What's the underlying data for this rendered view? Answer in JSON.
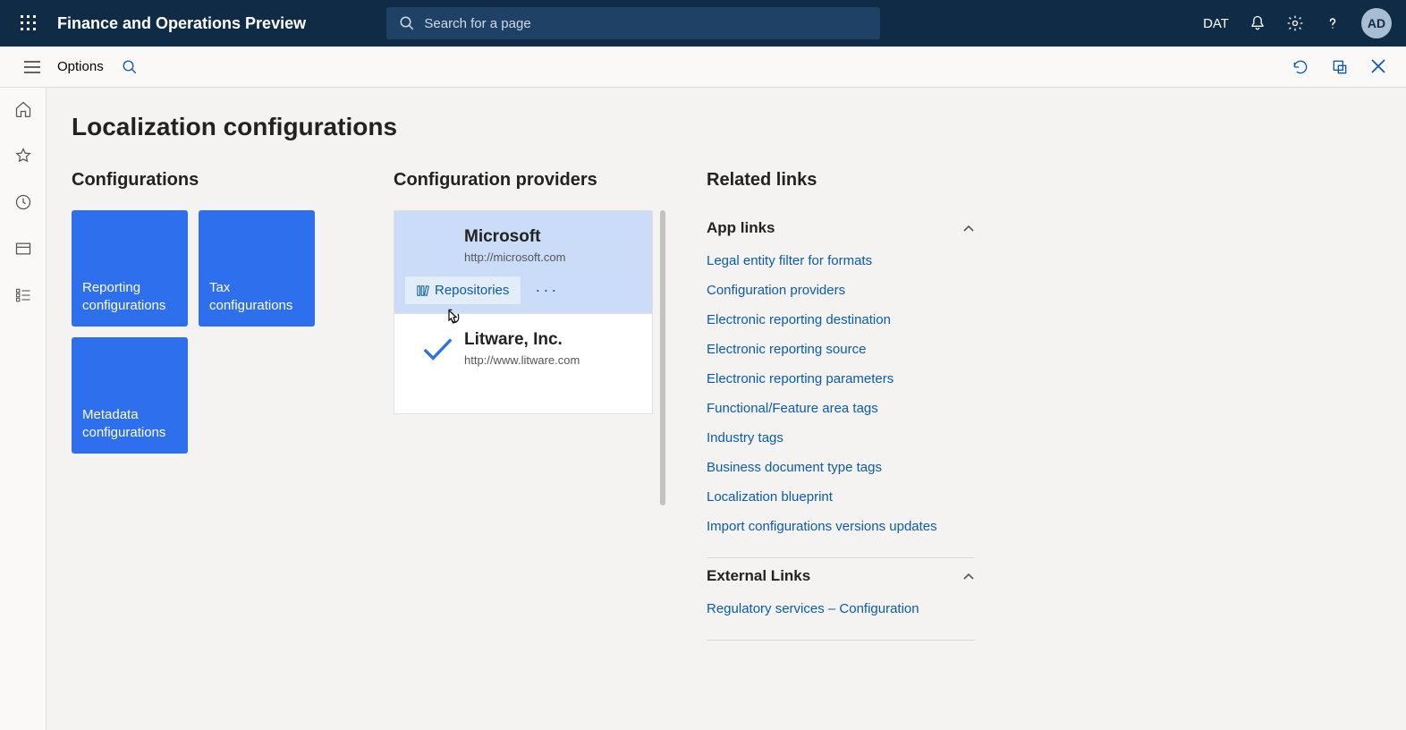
{
  "header": {
    "app_title": "Finance and Operations Preview",
    "search_placeholder": "Search for a page",
    "company": "DAT",
    "avatar_initials": "AD"
  },
  "secondbar": {
    "options": "Options"
  },
  "page": {
    "title": "Localization configurations"
  },
  "configurations": {
    "heading": "Configurations",
    "tiles": [
      "Reporting configurations",
      "Tax configurations",
      "Metadata configurations"
    ]
  },
  "providers": {
    "heading": "Configuration providers",
    "repositories_label": "Repositories",
    "items": [
      {
        "name": "Microsoft",
        "url": "http://microsoft.com",
        "selected": true,
        "active": false
      },
      {
        "name": "Litware, Inc.",
        "url": "http://www.litware.com",
        "selected": false,
        "active": true
      }
    ]
  },
  "related": {
    "heading": "Related links",
    "app_links_heading": "App links",
    "app_links": [
      "Legal entity filter for formats",
      "Configuration providers",
      "Electronic reporting destination",
      "Electronic reporting source",
      "Electronic reporting parameters",
      "Functional/Feature area tags",
      "Industry tags",
      "Business document type tags",
      "Localization blueprint",
      "Import configurations versions updates"
    ],
    "external_heading": "External Links",
    "external_links": [
      "Regulatory services – Configuration"
    ]
  }
}
